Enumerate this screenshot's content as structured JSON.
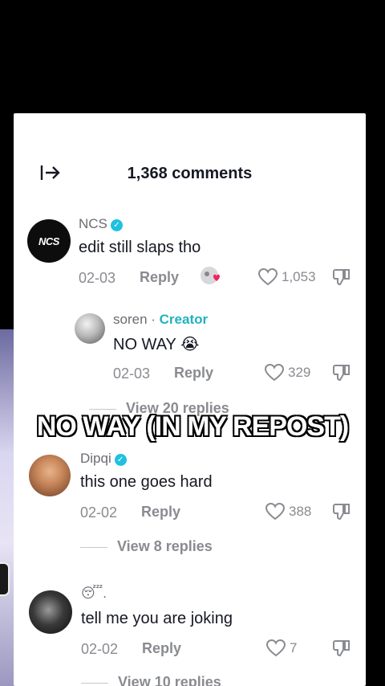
{
  "header": {
    "title": "1,368 comments"
  },
  "overlay_caption": "NO WAY (IN MY REPOST)",
  "comments": [
    {
      "username": "NCS",
      "verified": true,
      "avatar_text": "NCS",
      "text": "edit still slaps tho",
      "date": "02-03",
      "reply_label": "Reply",
      "likes": "1,053"
    },
    {
      "username": "soren",
      "creator_badge": "Creator",
      "text": "NO WAY 😭",
      "date": "02-03",
      "reply_label": "Reply",
      "likes": "329",
      "view_replies": "View 20 replies"
    },
    {
      "username": "Dipqi",
      "verified": true,
      "text": "this one goes hard",
      "date": "02-02",
      "reply_label": "Reply",
      "likes": "388",
      "view_replies": "View 8 replies"
    },
    {
      "username": "😴.",
      "text": "tell me you are joking",
      "date": "02-02",
      "reply_label": "Reply",
      "likes": "7",
      "view_replies": "View 10 replies"
    }
  ],
  "colors": {
    "creator": "#1fb3c0",
    "verified": "#20c0e0",
    "text": "#161823",
    "muted": "#8a8b91"
  }
}
